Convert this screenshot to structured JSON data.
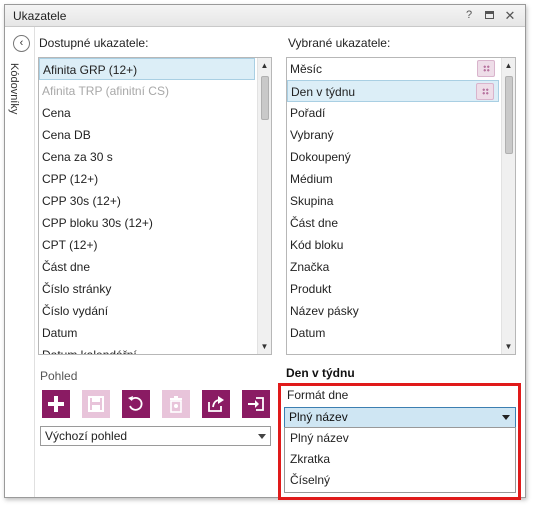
{
  "window": {
    "title": "Ukazatele",
    "help_glyph": "?",
    "close_glyph": "✕"
  },
  "sidebar": {
    "back_glyph": "‹",
    "vertical_label": "Kódovníky"
  },
  "available": {
    "label": "Dostupné ukazatele:",
    "items": [
      {
        "label": "Afinita GRP (12+)",
        "selected": true
      },
      {
        "label": "Afinita TRP (afinitní CS)",
        "disabled": true
      },
      {
        "label": "Cena"
      },
      {
        "label": "Cena DB"
      },
      {
        "label": "Cena za 30 s"
      },
      {
        "label": "CPP (12+)"
      },
      {
        "label": "CPP 30s (12+)"
      },
      {
        "label": "CPP bloku 30s (12+)"
      },
      {
        "label": "CPT (12+)"
      },
      {
        "label": "Část dne"
      },
      {
        "label": "Číslo stránky"
      },
      {
        "label": "Číslo vydání"
      },
      {
        "label": "Datum"
      },
      {
        "label": "Datum kalendářní"
      }
    ]
  },
  "selected": {
    "label": "Vybrané ukazatele:",
    "items": [
      {
        "label": "Měsíc",
        "grip": true
      },
      {
        "label": "Den v týdnu",
        "grip": true,
        "selected": true
      },
      {
        "label": "Pořadí"
      },
      {
        "label": "Vybraný"
      },
      {
        "label": "Dokoupený"
      },
      {
        "label": "Médium"
      },
      {
        "label": "Skupina"
      },
      {
        "label": "Část dne"
      },
      {
        "label": "Kód bloku"
      },
      {
        "label": "Značka"
      },
      {
        "label": "Produkt"
      },
      {
        "label": "Název pásky"
      },
      {
        "label": "Datum"
      }
    ]
  },
  "view": {
    "label": "Pohled",
    "toolbar": [
      {
        "name": "add-view-button",
        "icon": "plus-icon",
        "enabled": true
      },
      {
        "name": "save-view-button",
        "icon": "save-icon",
        "enabled": false
      },
      {
        "name": "reset-view-button",
        "icon": "undo-icon",
        "enabled": true
      },
      {
        "name": "delete-view-button",
        "icon": "trash-icon",
        "enabled": false
      },
      {
        "name": "export-view-button",
        "icon": "share-icon",
        "enabled": true
      },
      {
        "name": "import-view-button",
        "icon": "import-icon",
        "enabled": true
      }
    ],
    "combo_value": "Výchozí pohled"
  },
  "detail": {
    "title": "Den v týdnu",
    "format_label": "Formát dne",
    "format_value": "Plný název",
    "options": [
      "Plný název",
      "Zkratka",
      "Číselný"
    ]
  },
  "colors": {
    "accent": "#8a1b63",
    "accent_disabled": "#e8c4da",
    "selection": "#dceef7",
    "highlight_frame": "#e01a1a"
  }
}
